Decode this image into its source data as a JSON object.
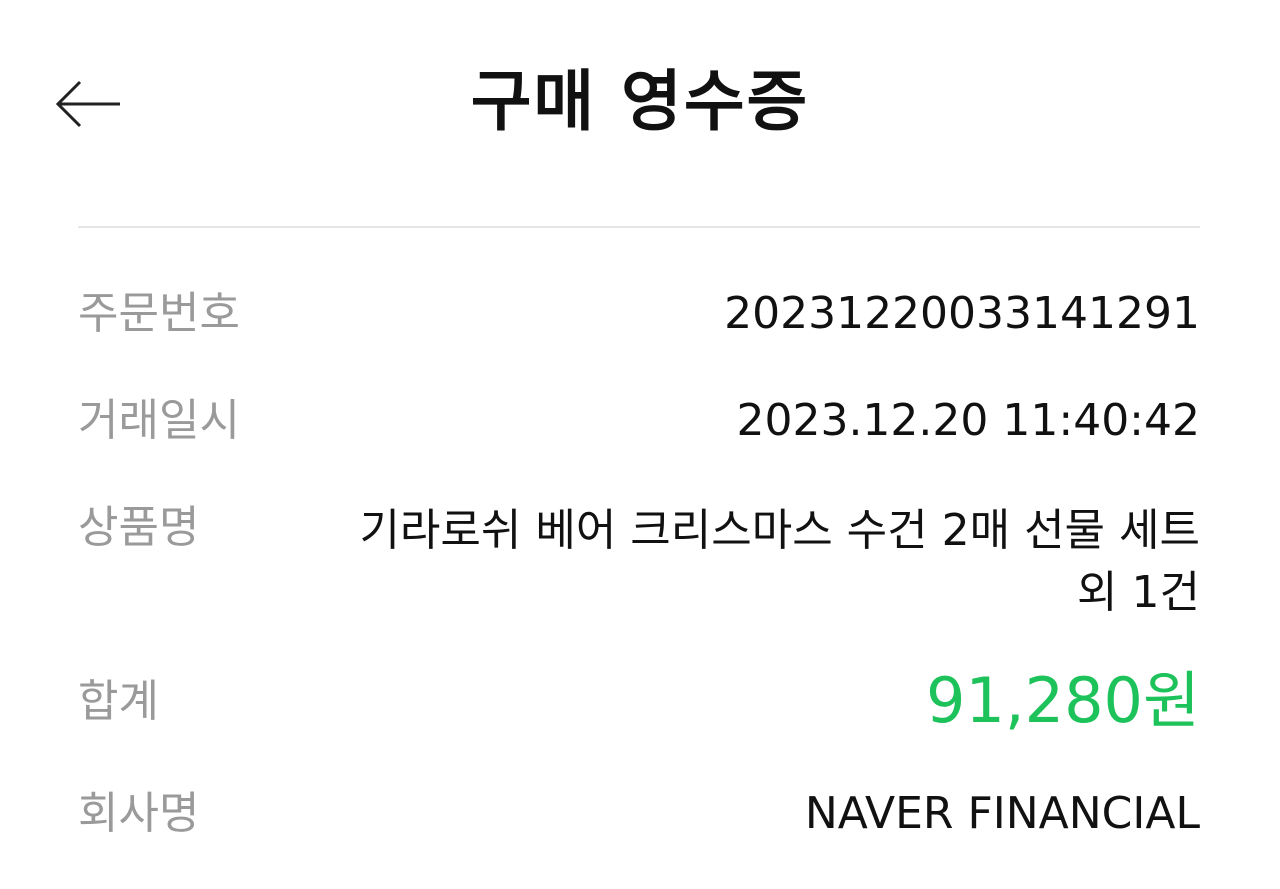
{
  "header": {
    "title": "구매 영수증",
    "back_icon": "arrow-left-icon"
  },
  "receipt": {
    "order_number": {
      "label": "주문번호",
      "value": "20231220033141291"
    },
    "transaction_datetime": {
      "label": "거래일시",
      "value": "2023.12.20 11:40:42"
    },
    "product_name": {
      "label": "상품명",
      "value": "기라로쉬 베어 크리스마스 수건 2매 선물 세트 외 1건"
    },
    "total": {
      "label": "합계",
      "value": "91,280원"
    },
    "company_name": {
      "label": "회사명",
      "value": "NAVER FINANCIAL"
    }
  },
  "colors": {
    "accent_total": "#1ec25a",
    "label_gray": "#9a9a9a",
    "divider": "#e6e6e6"
  }
}
